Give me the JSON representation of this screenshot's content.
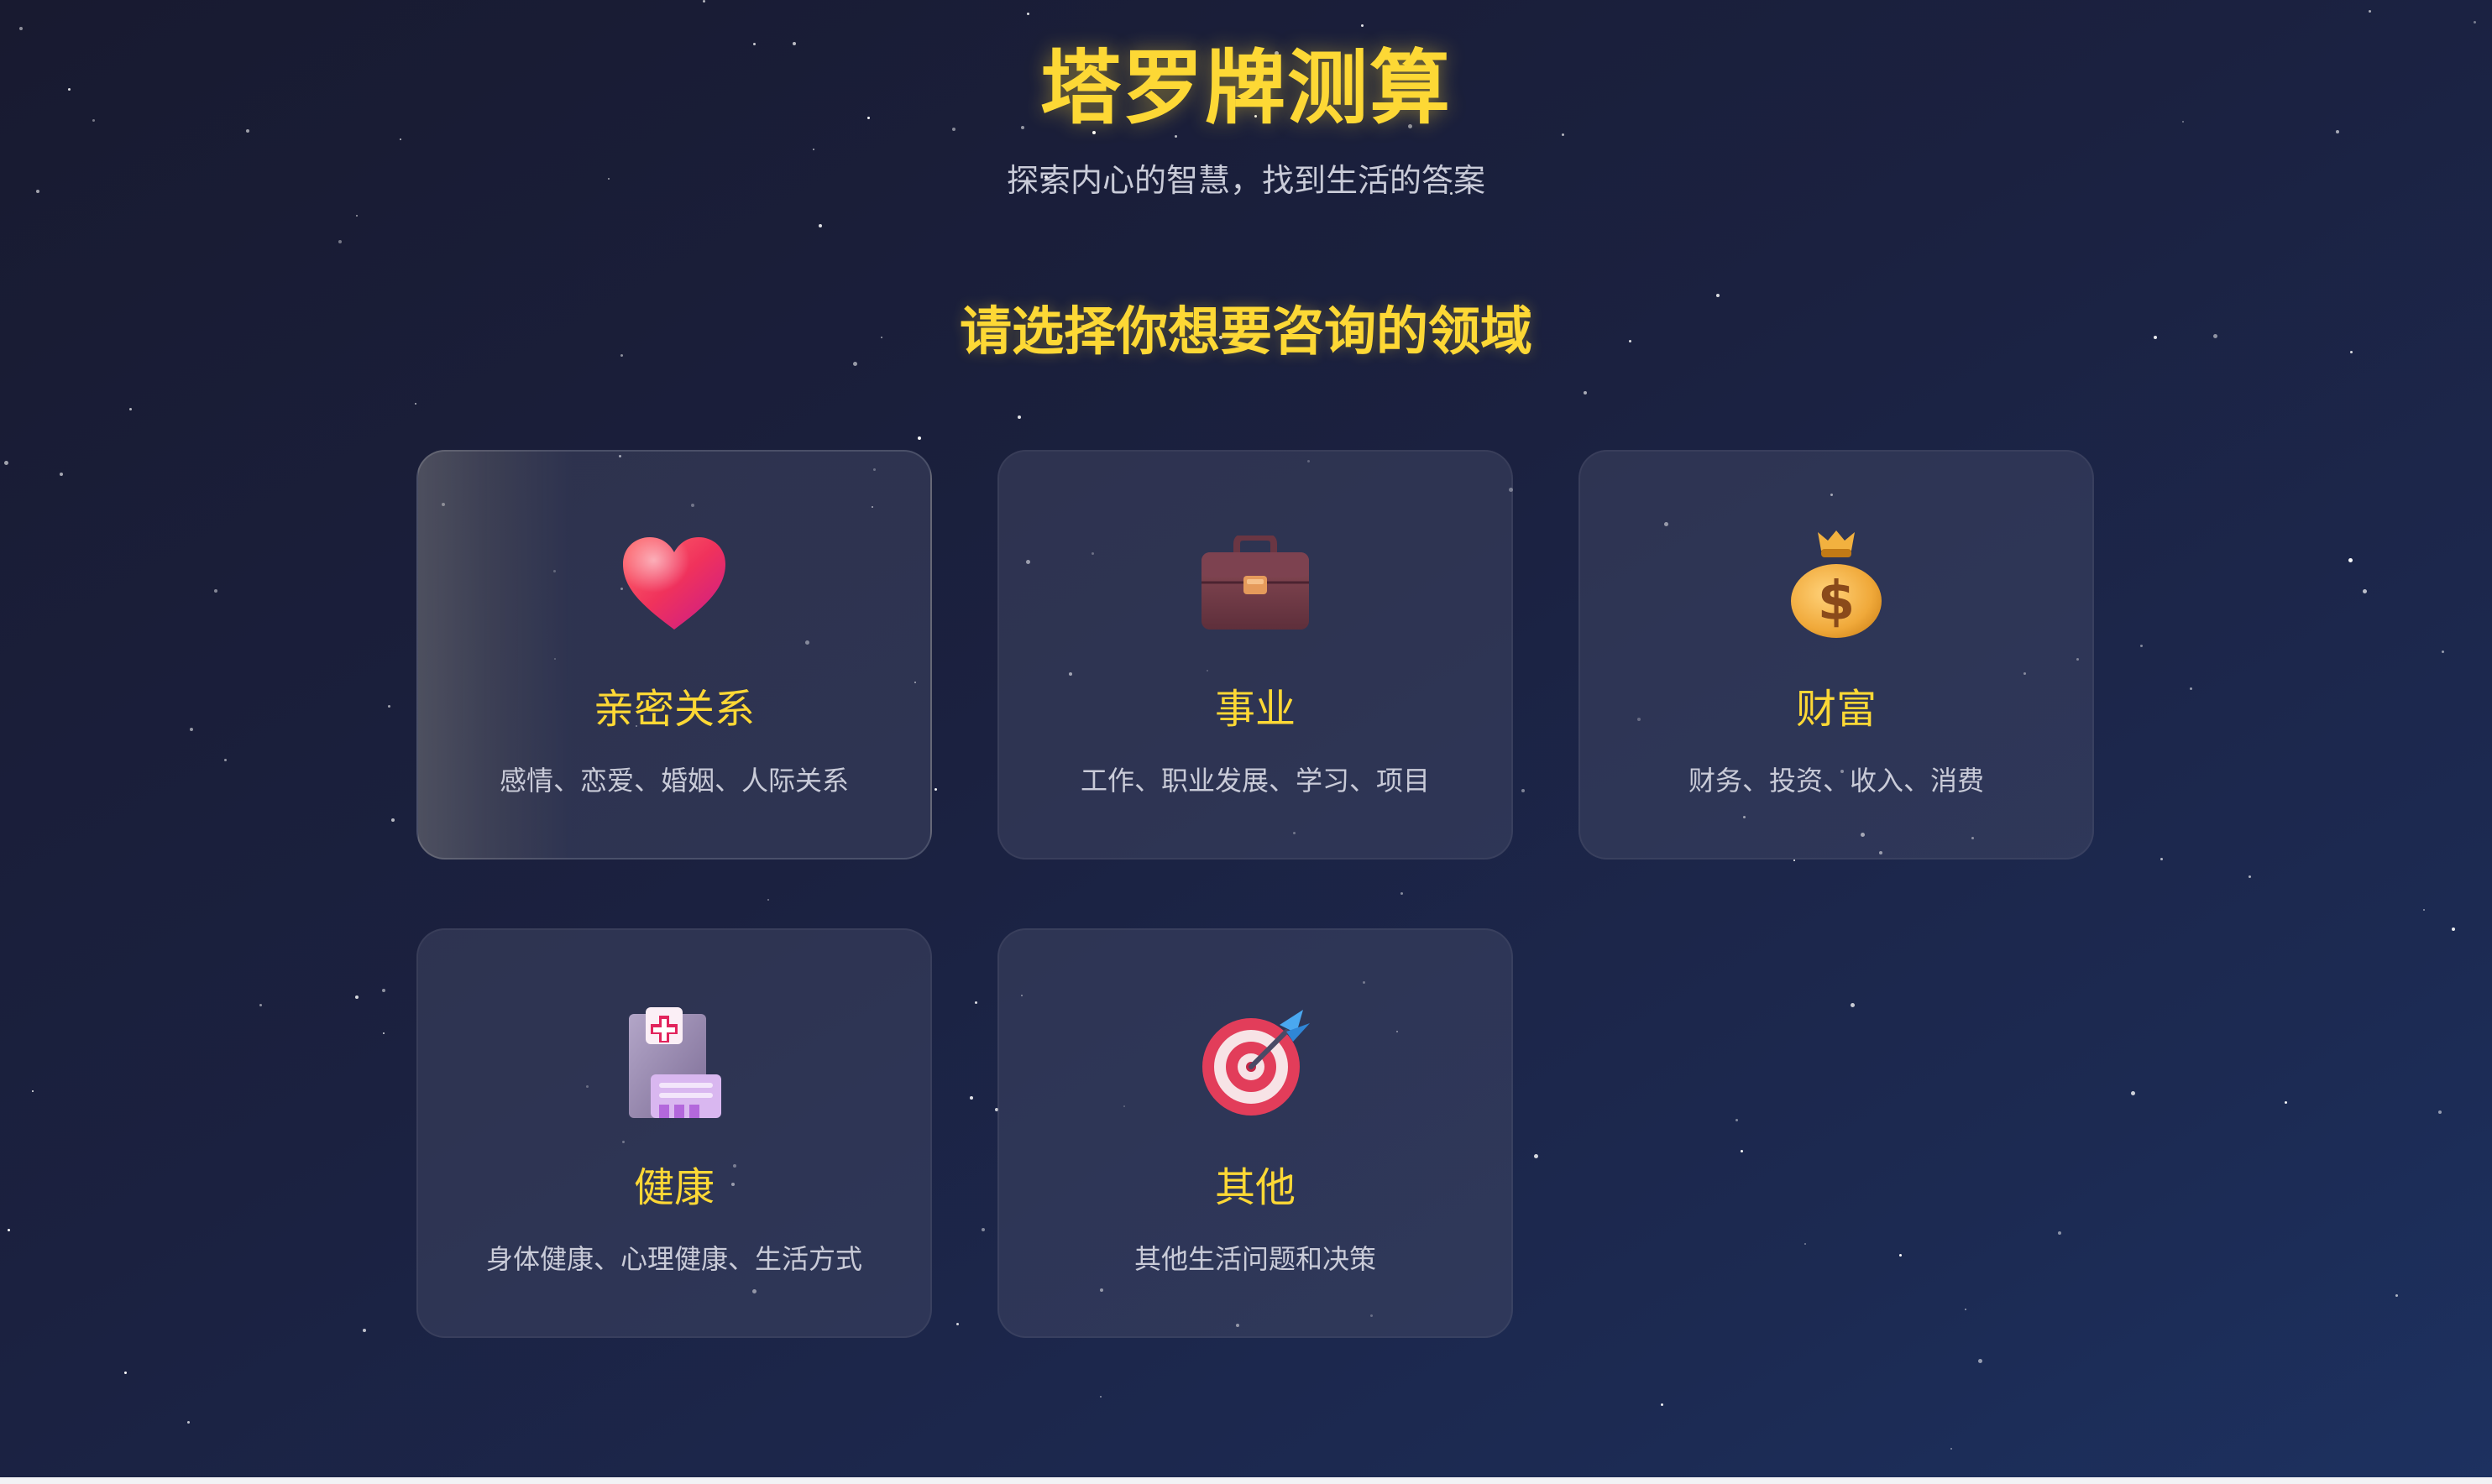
{
  "header": {
    "title": "塔罗牌测算",
    "subtitle": "探索内心的智慧，找到生活的答案"
  },
  "section": {
    "title": "请选择你想要咨询的领域"
  },
  "categories": [
    {
      "title": "亲密关系",
      "description": "感情、恋爱、婚姻、人际关系",
      "icon": "heart-icon",
      "selected": true
    },
    {
      "title": "事业",
      "description": "工作、职业发展、学习、项目",
      "icon": "briefcase-icon",
      "selected": false
    },
    {
      "title": "财富",
      "description": "财务、投资、收入、消费",
      "icon": "money-bag-icon",
      "selected": false
    },
    {
      "title": "健康",
      "description": "身体健康、心理健康、生活方式",
      "icon": "hospital-icon",
      "selected": false
    },
    {
      "title": "其他",
      "description": "其他生活问题和决策",
      "icon": "dart-target-icon",
      "selected": false
    }
  ],
  "colors": {
    "accent": "#fdd835",
    "background_start": "#181a30",
    "background_end": "#1d3160",
    "card_background": "#2f3450",
    "muted_text": "#c9cbd8"
  }
}
